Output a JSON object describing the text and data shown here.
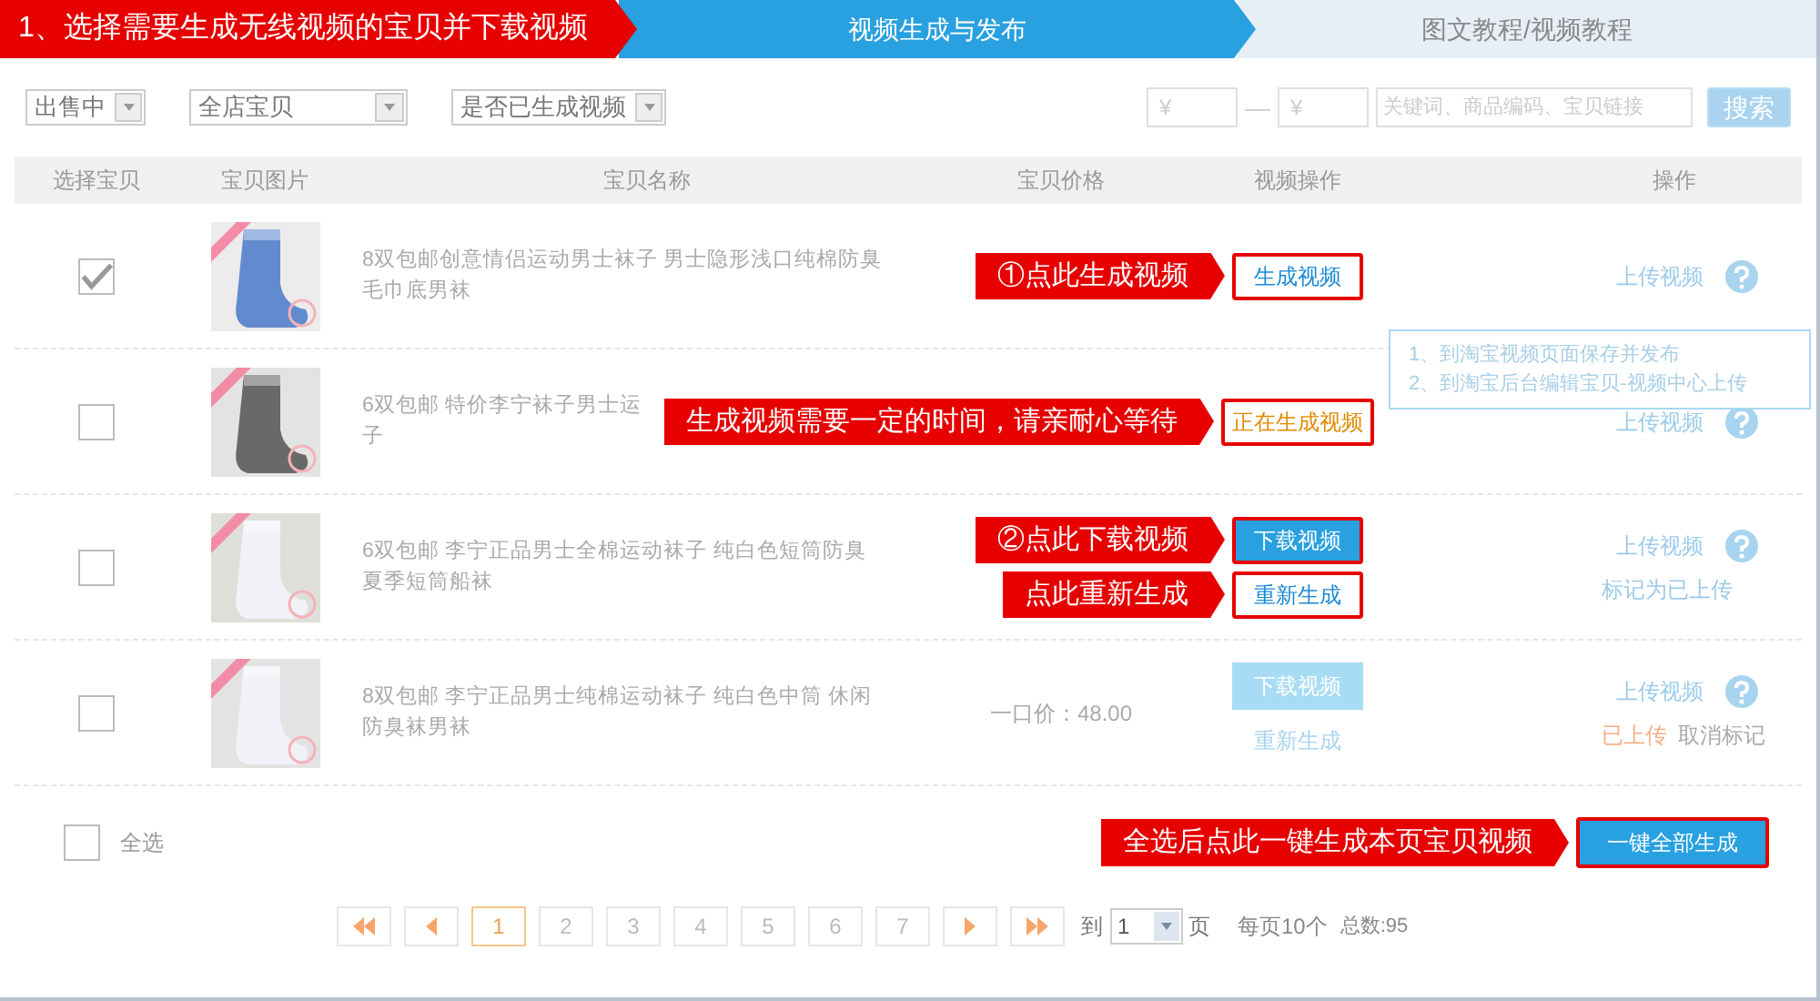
{
  "steps": [
    {
      "label": "1、选择需要生成无线视频的宝贝并下载视频",
      "kind": "highlight"
    },
    {
      "label": "视频生成与发布",
      "kind": "active"
    },
    {
      "label": "图文教程/视频教程",
      "kind": "plain"
    }
  ],
  "filters": [
    {
      "value": "出售中"
    },
    {
      "value": "全店宝贝"
    },
    {
      "value": "是否已生成视频"
    }
  ],
  "price_min": {
    "placeholder": "¥"
  },
  "price_separator": "—",
  "price_max": {
    "placeholder": "¥"
  },
  "keyword": {
    "placeholder": "关键词、商品编码、宝贝链接"
  },
  "search_button": "搜索",
  "columns": [
    "选择宝贝",
    "宝贝图片",
    "宝贝名称",
    "宝贝价格",
    "视频操作",
    "操作"
  ],
  "rows": [
    {
      "checked": true,
      "image": {
        "kind": "picture"
      },
      "name": [
        "8双包邮创意情侣运动男士袜子 男士隐形浅口纯棉防臭",
        "毛巾底男袜"
      ],
      "video_actions": [
        {
          "label": "生成视频",
          "kind": "outline",
          "highlighted": true,
          "callout": "①点此生成视频"
        }
      ],
      "ops": [
        {
          "label": "上传视频",
          "kind": "link"
        }
      ],
      "tooltip": [
        "1、到淘宝视频页面保存并发布",
        "2、到淘宝后台编辑宝贝-视频中心上传"
      ]
    },
    {
      "checked": false,
      "image": {
        "kind": "picture"
      },
      "name": [
        "6双包邮 特价李宁袜子男士运",
        "子"
      ],
      "video_actions": [
        {
          "label": "正在生成视频",
          "kind": "pending",
          "highlighted": true,
          "callout": "生成视频需要一定的时间，请亲耐心等待"
        }
      ],
      "ops": [
        {
          "label": "上传视频",
          "kind": "link"
        }
      ]
    },
    {
      "checked": false,
      "image": {
        "kind": "picture"
      },
      "name": [
        "6双包邮 李宁正品男士全棉运动袜子 纯白色短筒防臭",
        "夏季短筒船袜"
      ],
      "video_actions": [
        {
          "label": "下载视频",
          "kind": "primary",
          "highlighted": true,
          "callout": "②点此下载视频"
        },
        {
          "label": "重新生成",
          "kind": "outline",
          "highlighted": true,
          "callout": "点此重新生成"
        }
      ],
      "ops": [
        {
          "label": "上传视频",
          "kind": "link"
        },
        {
          "label": "标记为已上传",
          "kind": "link"
        }
      ]
    },
    {
      "checked": false,
      "image": {
        "kind": "picture"
      },
      "name": [
        "8双包邮 李宁正品男士纯棉运动袜子 纯白色中筒 休闲",
        "防臭袜男袜"
      ],
      "price": "一口价：48.00",
      "video_actions": [
        {
          "label": "下载视频",
          "kind": "primary",
          "highlighted": false
        },
        {
          "label": "重新生成",
          "kind": "link",
          "highlighted": false
        }
      ],
      "ops": [
        {
          "label": "上传视频",
          "kind": "link"
        },
        {
          "label": "已上传",
          "kind": "status"
        },
        {
          "label": "取消标记",
          "kind": "muted"
        }
      ]
    }
  ],
  "select_all": {
    "label": "全选",
    "checked": false
  },
  "bulk_button": {
    "label": "一键全部生成",
    "highlighted": true,
    "callout": "全选后点此一键生成本页宝贝视频"
  },
  "pagination": {
    "pages": [
      {
        "label": "1",
        "selected": true
      },
      {
        "label": "2",
        "selected": false
      },
      {
        "label": "3",
        "selected": false
      },
      {
        "label": "4",
        "selected": false
      },
      {
        "label": "5",
        "selected": false
      },
      {
        "label": "6",
        "selected": false
      },
      {
        "label": "7",
        "selected": false
      }
    ],
    "goto_label": "到",
    "goto_value": "1",
    "page_unit": "页",
    "per_page": "每页10个",
    "total": "总数:95"
  }
}
